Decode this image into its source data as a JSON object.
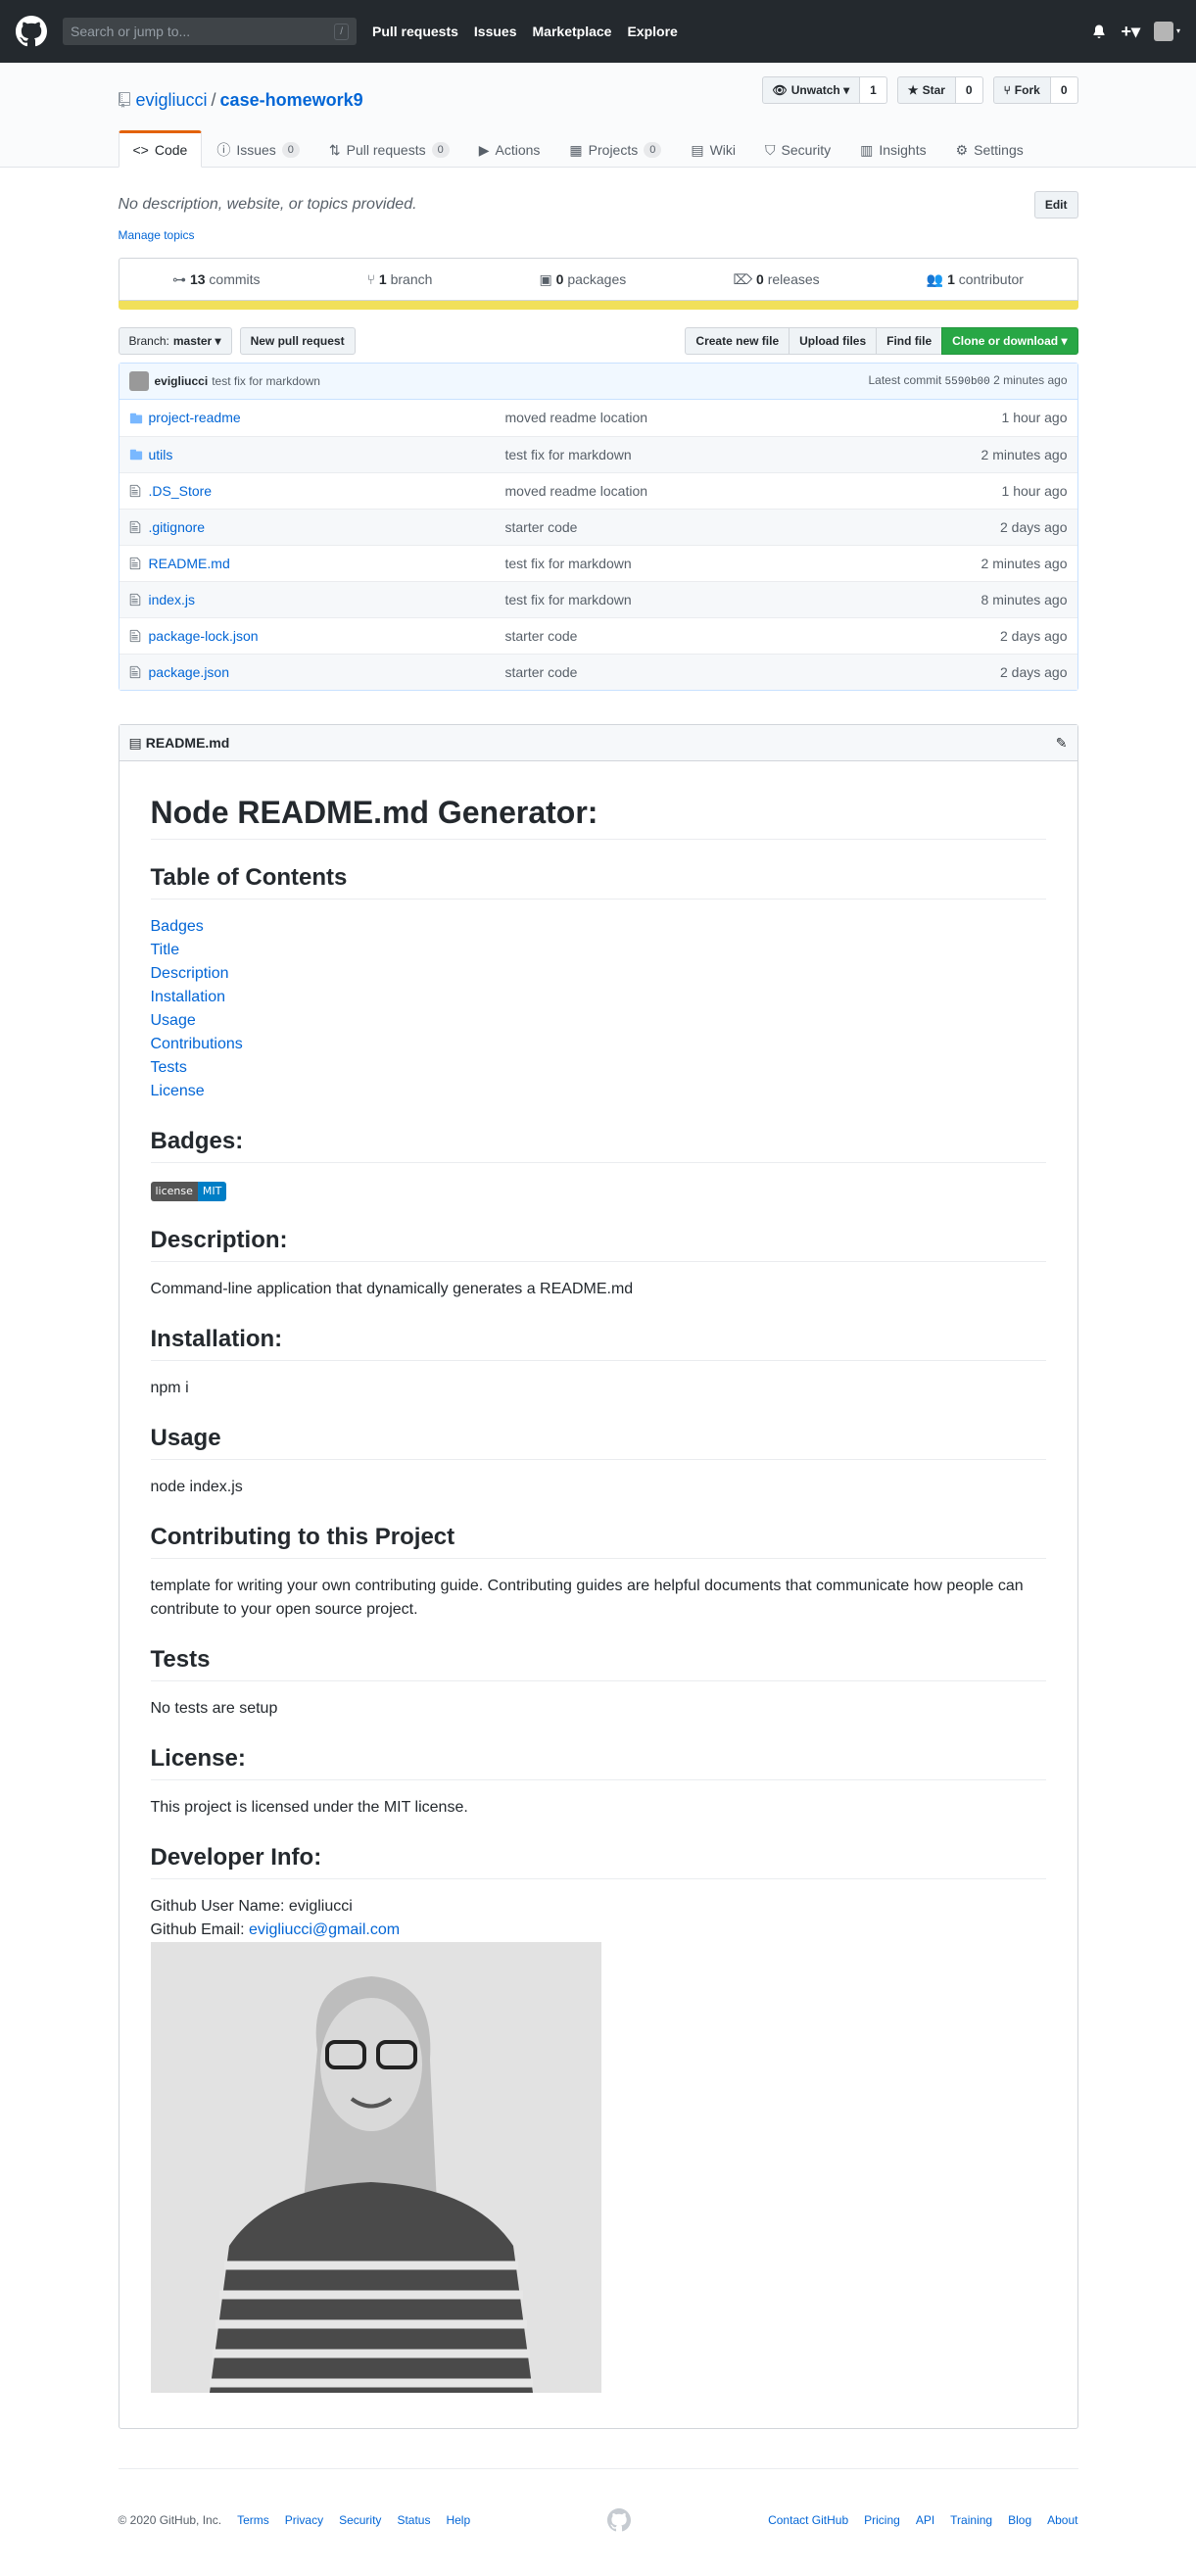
{
  "header": {
    "search_placeholder": "Search or jump to...",
    "slash": "/",
    "nav": [
      "Pull requests",
      "Issues",
      "Marketplace",
      "Explore"
    ],
    "plus": "+▾"
  },
  "repo": {
    "owner": "evigliucci",
    "sep": "/",
    "name": "case-homework9",
    "watch_label": "Unwatch ▾",
    "watch_count": "1",
    "star_label": "Star",
    "star_count": "0",
    "fork_label": "Fork",
    "fork_count": "0"
  },
  "tabs": [
    {
      "label": "Code"
    },
    {
      "label": "Issues",
      "count": "0"
    },
    {
      "label": "Pull requests",
      "count": "0"
    },
    {
      "label": "Actions"
    },
    {
      "label": "Projects",
      "count": "0"
    },
    {
      "label": "Wiki"
    },
    {
      "label": "Security"
    },
    {
      "label": "Insights"
    },
    {
      "label": "Settings"
    }
  ],
  "about": {
    "description": "No description, website, or topics provided.",
    "edit": "Edit",
    "manage_topics": "Manage topics"
  },
  "summary": {
    "commits_n": "13",
    "commits": "commits",
    "branch_n": "1",
    "branch": "branch",
    "packages_n": "0",
    "packages": "packages",
    "releases_n": "0",
    "releases": "releases",
    "contributors_n": "1",
    "contributors": "contributor"
  },
  "toolbar": {
    "branch": "Branch:",
    "branch_name": "master ▾",
    "new_pr": "New pull request",
    "create_file": "Create new file",
    "upload": "Upload files",
    "find": "Find file",
    "clone": "Clone or download ▾"
  },
  "commit": {
    "author": "evigliucci",
    "message": "test fix for markdown",
    "latest": "Latest commit",
    "sha": "5590b00",
    "age": "2 minutes ago"
  },
  "files": [
    {
      "type": "dir",
      "name": "project-readme",
      "msg": "moved readme location",
      "age": "1 hour ago"
    },
    {
      "type": "dir",
      "name": "utils",
      "msg": "test fix for markdown",
      "age": "2 minutes ago"
    },
    {
      "type": "file",
      "name": ".DS_Store",
      "msg": "moved readme location",
      "age": "1 hour ago"
    },
    {
      "type": "file",
      "name": ".gitignore",
      "msg": "starter code",
      "age": "2 days ago"
    },
    {
      "type": "file",
      "name": "README.md",
      "msg": "test fix for markdown",
      "age": "2 minutes ago"
    },
    {
      "type": "file",
      "name": "index.js",
      "msg": "test fix for markdown",
      "age": "8 minutes ago"
    },
    {
      "type": "file",
      "name": "package-lock.json",
      "msg": "starter code",
      "age": "2 days ago"
    },
    {
      "type": "file",
      "name": "package.json",
      "msg": "starter code",
      "age": "2 days ago"
    }
  ],
  "readme": {
    "header": "README.md",
    "h1": "Node README.md Generator:",
    "toc_title": "Table of Contents",
    "toc": [
      "Badges",
      "Title",
      "Description",
      "Installation",
      "Usage",
      "Contributions",
      "Tests",
      "License"
    ],
    "badges_title": "Badges:",
    "badge_left": "license",
    "badge_right": "MIT",
    "desc_title": "Description:",
    "desc_text": "Command-line application that dynamically generates a README.md",
    "install_title": "Installation:",
    "install_text": "npm i",
    "usage_title": "Usage",
    "usage_text": "node index.js",
    "contrib_title": "Contributing to this Project",
    "contrib_text": "template for writing your own contributing guide. Contributing guides are helpful documents that communicate how people can contribute to your open source project.",
    "tests_title": "Tests",
    "tests_text": "No tests are setup",
    "license_title": "License:",
    "license_text": "This project is licensed under the MIT license.",
    "dev_title": "Developer Info:",
    "dev_user": "Github User Name: evigliucci",
    "dev_email_label": "Github Email: ",
    "dev_email": "evigliucci@gmail.com"
  },
  "footer": {
    "copyright": "© 2020 GitHub, Inc.",
    "left_links": [
      "Terms",
      "Privacy",
      "Security",
      "Status",
      "Help"
    ],
    "right_links": [
      "Contact GitHub",
      "Pricing",
      "API",
      "Training",
      "Blog",
      "About"
    ]
  },
  "colors": {
    "accent": "#0366d6",
    "header_bg": "#24292e",
    "green": "#28a745",
    "language_bar": "#f1e05a",
    "tab_underline": "#e36209"
  }
}
